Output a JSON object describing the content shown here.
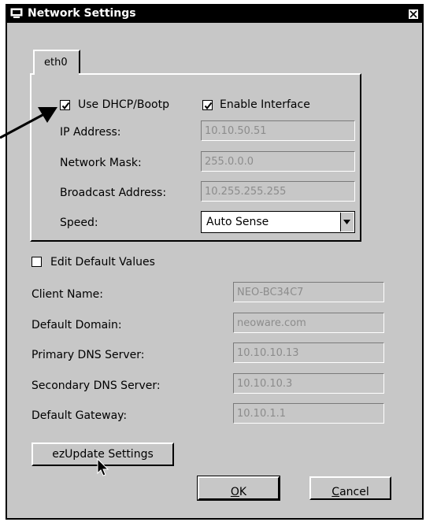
{
  "window": {
    "title": "Network Settings"
  },
  "tab": {
    "label": "eth0"
  },
  "interface": {
    "use_dhcp_label": "Use DHCP/Bootp",
    "use_dhcp_checked": true,
    "enable_interface_label": "Enable Interface",
    "enable_interface_checked": true,
    "ip_address_label": "IP Address:",
    "ip_address_value": "10.10.50.51",
    "network_mask_label": "Network Mask:",
    "network_mask_value": "255.0.0.0",
    "broadcast_label": "Broadcast Address:",
    "broadcast_value": "10.255.255.255",
    "speed_label": "Speed:",
    "speed_value": "Auto Sense"
  },
  "defaults": {
    "edit_defaults_label": "Edit Default Values",
    "edit_defaults_checked": false,
    "client_name_label": "Client Name:",
    "client_name_value": "NEO-BC34C7",
    "default_domain_label": "Default Domain:",
    "default_domain_value": "neoware.com",
    "primary_dns_label": "Primary DNS Server:",
    "primary_dns_value": "10.10.10.13",
    "secondary_dns_label": "Secondary DNS Server:",
    "secondary_dns_value": "10.10.10.3",
    "default_gateway_label": "Default Gateway:",
    "default_gateway_value": "10.10.1.1"
  },
  "buttons": {
    "ezupdate_label": "ezUpdate Settings",
    "ok_mnemonic": "O",
    "ok_rest": "K",
    "cancel_mnemonic": "C",
    "cancel_rest": "ancel"
  },
  "icons": {
    "window_icon": "monitor-icon",
    "close": "close-icon",
    "dropdown": "chevron-down-icon",
    "callout": "arrow-icon",
    "cursor": "mouse-pointer-icon"
  }
}
